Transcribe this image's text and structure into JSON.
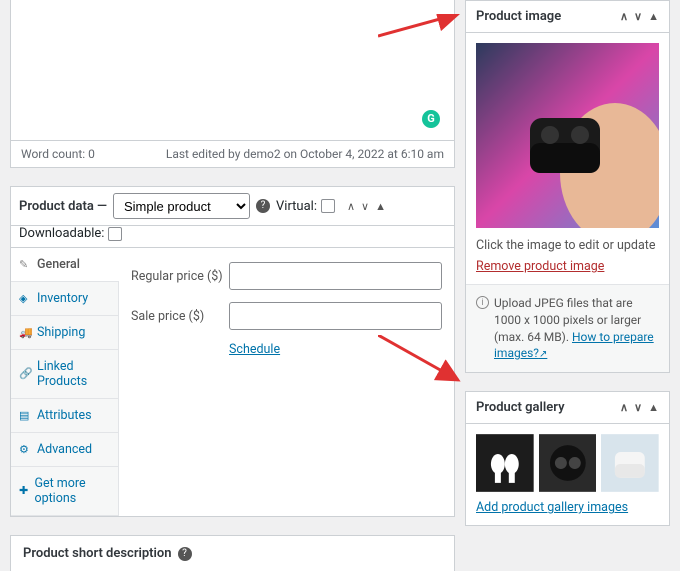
{
  "editor": {
    "word_count": "Word count: 0",
    "last_edited": "Last edited by demo2 on October 4, 2022 at 6:10 am",
    "grammarly": "G"
  },
  "product_data": {
    "label": "Product data —",
    "type_value": "Simple product",
    "virtual_label": "Virtual:",
    "downloadable_label": "Downloadable:",
    "tabs": [
      "General",
      "Inventory",
      "Shipping",
      "Linked Products",
      "Attributes",
      "Advanced",
      "Get more options"
    ],
    "regular_price_label": "Regular price ($)",
    "sale_price_label": "Sale price ($)",
    "schedule": "Schedule"
  },
  "short_desc": {
    "title": "Product short description"
  },
  "product_image": {
    "title": "Product image",
    "click_text": "Click the image to edit or update",
    "remove": "Remove product image",
    "upload_note_pre": "Upload JPEG files that are 1000 x 1000 pixels or larger (max. 64 MB). ",
    "how_to": "How to prepare images?"
  },
  "product_gallery": {
    "title": "Product gallery",
    "add_link": "Add product gallery images"
  }
}
